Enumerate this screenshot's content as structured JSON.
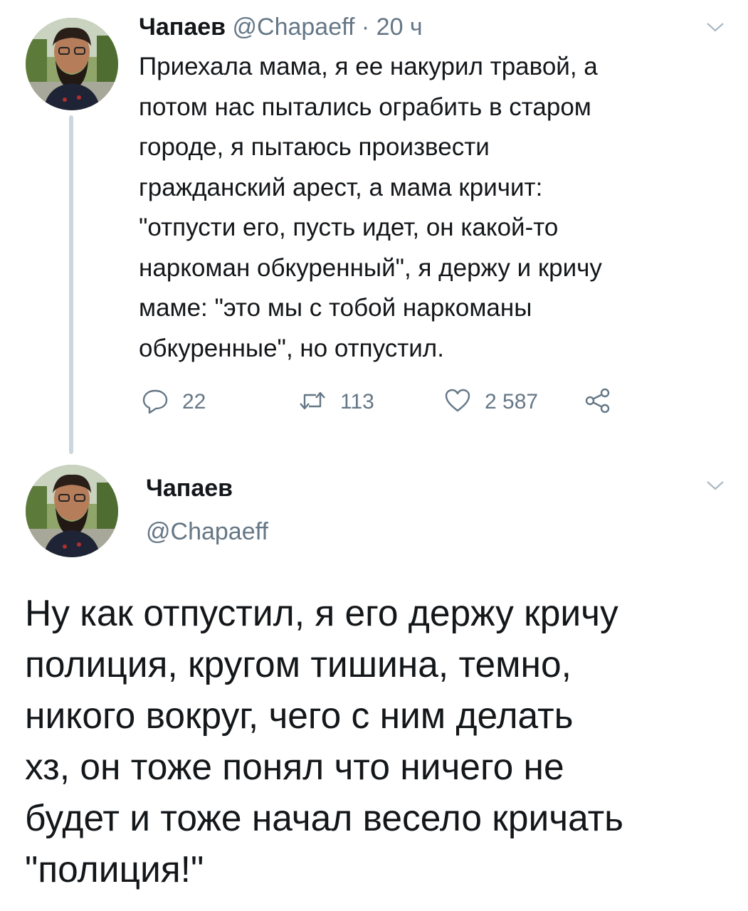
{
  "tweet1": {
    "display_name": "Чапаев",
    "handle": "@Chapaeff",
    "separator": "·",
    "time": "20 ч",
    "text": "Приехала мама, я ее накурил травой, а\nпотом нас пытались ограбить в старом\nгороде, я пытаюсь произвести\nгражданский арест, а мама кричит:\n\"отпусти его, пусть идет, он какой-то\nнаркоман обкуренный\", я держу и кричу\nмаме: \"это мы с тобой наркоманы\nобкуренные\", но отпустил.",
    "actions": {
      "replies": "22",
      "retweets": "113",
      "likes": "2 587"
    }
  },
  "tweet2": {
    "display_name": "Чапаев",
    "handle": "@Chapaeff",
    "text": "Ну как отпустил, я его держу кричу\nполиция, кругом тишина, темно,\nникого вокруг, чего с ним делать\nхз, он тоже понял что ничего не\nбудет и тоже начал весело кричать\n\"полиция!\""
  },
  "icons": {
    "reply": "reply-icon",
    "retweet": "retweet-icon",
    "like": "heart-icon",
    "share": "share-icon",
    "more": "chevron-down-icon"
  },
  "colors": {
    "text": "#14171a",
    "secondary": "#657786",
    "thread_line": "#ccd6dd"
  }
}
